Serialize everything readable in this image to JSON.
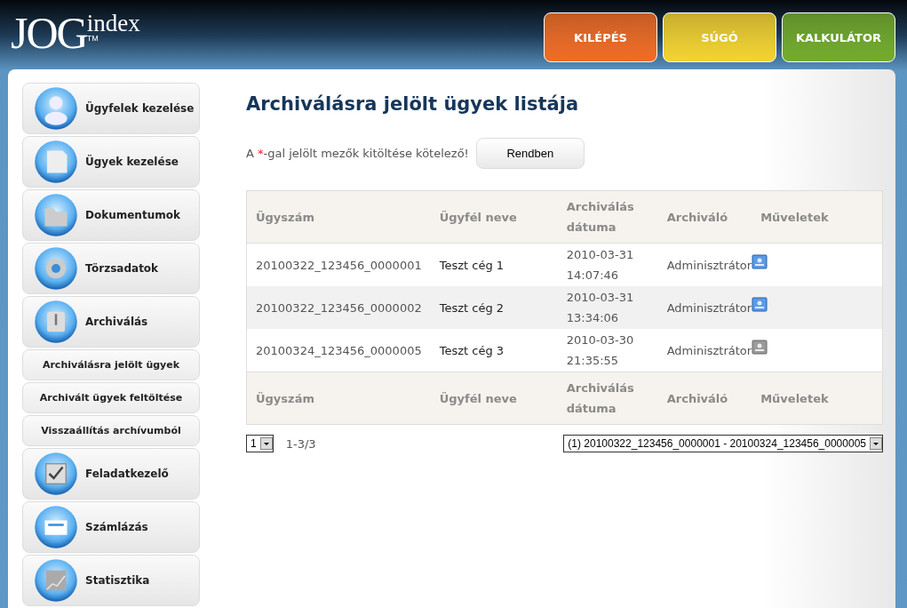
{
  "logo": {
    "main": "JOG",
    "sup": "index",
    "tm": "TM"
  },
  "top_buttons": [
    {
      "label": "KILÉPÉS",
      "color": "#f26b22"
    },
    {
      "label": "SÚGÓ",
      "color": "#f5d22e"
    },
    {
      "label": "KALKULÁTOR",
      "color": "#74ab2a"
    }
  ],
  "sidebar": {
    "items": [
      {
        "label": "Ügyfelek kezelése",
        "kind": "main"
      },
      {
        "label": "Ügyek kezelése",
        "kind": "main"
      },
      {
        "label": "Dokumentumok",
        "kind": "main"
      },
      {
        "label": "Törzsadatok",
        "kind": "main"
      },
      {
        "label": "Archiválás",
        "kind": "main"
      },
      {
        "label": "Archiválásra jelölt ügyek",
        "kind": "sub"
      },
      {
        "label": "Archivált ügyek feltöltése",
        "kind": "sub"
      },
      {
        "label": "Visszaállítás archívumból",
        "kind": "sub"
      },
      {
        "label": "Feladatkezelő",
        "kind": "main"
      },
      {
        "label": "Számlázás",
        "kind": "main"
      },
      {
        "label": "Statisztika",
        "kind": "main"
      }
    ]
  },
  "page_title": "Archiválásra jelölt ügyek listája",
  "note": {
    "before": "A ",
    "mark": "*",
    "after": "-gal jelölt mezők kitöltése kötelező!"
  },
  "ok_button": "Rendben",
  "table": {
    "columns": [
      "Ügyszám",
      "Ügyfél neve",
      "Archiválás dátuma",
      "Archiváló",
      "Műveletek"
    ],
    "rows": [
      {
        "cells": [
          "20100322_123456_0000001",
          "Teszt cég 1",
          "2010-03-31 14:07:46",
          "Adminisztrátor"
        ],
        "action_enabled": true
      },
      {
        "cells": [
          "20100322_123456_0000002",
          "Teszt cég 2",
          "2010-03-31 13:34:06",
          "Adminisztrátor"
        ],
        "action_enabled": true
      },
      {
        "cells": [
          "20100324_123456_0000005",
          "Teszt cég 3",
          "2010-03-30 21:35:55",
          "Adminisztrátor"
        ],
        "action_enabled": false
      }
    ],
    "footer_columns": [
      "Ügyszám",
      "Ügyfél neve",
      "Archiválás dátuma",
      "Archiváló",
      "Műveletek"
    ]
  },
  "pagination": {
    "page_select": "1",
    "range": "1-3/3",
    "range_select": "(1) 20100322_123456_0000001 - 20100324_123456_0000005"
  }
}
